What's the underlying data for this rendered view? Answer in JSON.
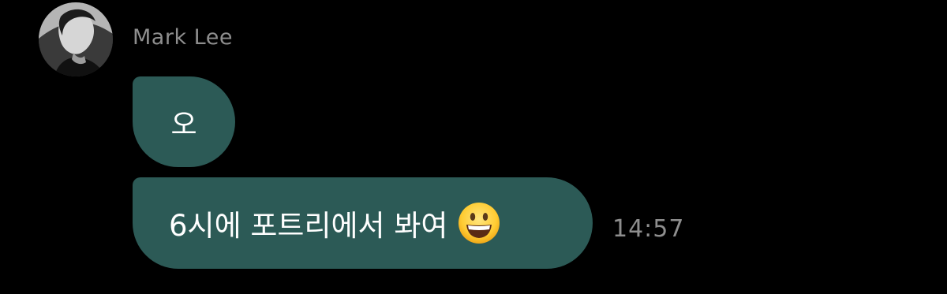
{
  "chat": {
    "sender_name": "Mark Lee",
    "messages": [
      {
        "text": "오"
      },
      {
        "text": "6시에 포트리에서 봐여",
        "emoji": "grinning-face-emoji"
      }
    ],
    "timestamp": "14:57"
  },
  "colors": {
    "background": "#000000",
    "bubble": "#2c5a56",
    "secondary_text": "#8e8e8e",
    "message_text": "#ffffff"
  },
  "icons": {
    "avatar": "profile-photo",
    "emoji": "grinning-face-emoji"
  }
}
